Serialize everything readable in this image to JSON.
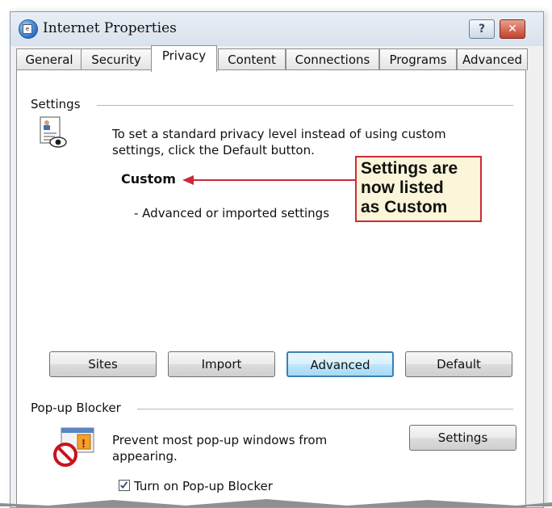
{
  "window": {
    "title": "Internet Properties",
    "help_glyph": "?",
    "close_glyph": "✕"
  },
  "tabs": [
    {
      "label": "General",
      "active": false
    },
    {
      "label": "Security",
      "active": false
    },
    {
      "label": "Privacy",
      "active": true
    },
    {
      "label": "Content",
      "active": false
    },
    {
      "label": "Connections",
      "active": false
    },
    {
      "label": "Programs",
      "active": false
    },
    {
      "label": "Advanced",
      "active": false
    }
  ],
  "settings_group": {
    "title": "Settings",
    "description_line1": "To set a standard privacy level instead of using custom",
    "description_line2": "settings, click the Default button.",
    "level": "Custom",
    "level_detail": "- Advanced or imported settings",
    "icon": "privacy-document-eye-icon"
  },
  "callout": {
    "lines": [
      "Settings are",
      "now listed",
      "as Custom"
    ],
    "border_color": "#cc2a3a",
    "arrow_color": "#cc2a3a"
  },
  "buttons": {
    "sites": "Sites",
    "import": "Import",
    "advanced": "Advanced",
    "default": "Default"
  },
  "popup_group": {
    "title": "Pop-up Blocker",
    "description_line1": "Prevent most pop-up windows from",
    "description_line2": "appearing.",
    "settings_button": "Settings",
    "checkbox_label": "Turn on Pop-up Blocker",
    "checkbox_checked": true,
    "icon": "popup-blocked-icon"
  }
}
